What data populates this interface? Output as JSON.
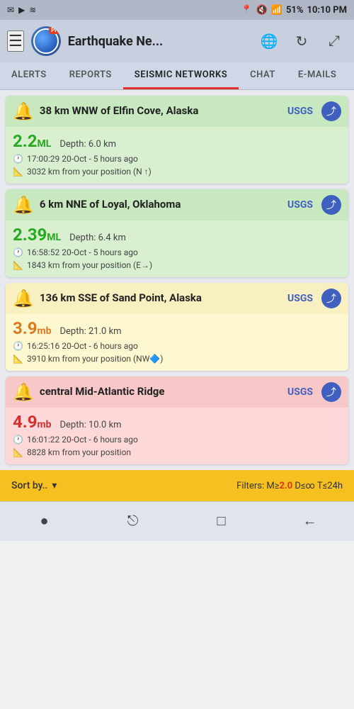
{
  "statusBar": {
    "leftIcons": [
      "✉",
      "▶",
      "≋"
    ],
    "rightItems": [
      "51%",
      "10:10 PM"
    ]
  },
  "header": {
    "title": "Earthquake Ne...",
    "menuIcon": "☰",
    "globeIcon": "🌐",
    "refreshIcon": "↻",
    "expandIcon": "⤢",
    "proBadge": "Pro"
  },
  "tabs": [
    {
      "id": "alerts",
      "label": "ALERTS",
      "active": false
    },
    {
      "id": "reports",
      "label": "REPORTS",
      "active": false
    },
    {
      "id": "seismic",
      "label": "SEISMIC NETWORKS",
      "active": true
    },
    {
      "id": "chat",
      "label": "CHAT",
      "active": false
    },
    {
      "id": "emails",
      "label": "E-MAILS",
      "active": false
    }
  ],
  "earthquakes": [
    {
      "id": "eq1",
      "color": "green",
      "location": "38 km WNW of Elfin Cove, Alaska",
      "source": "USGS",
      "magnitude": "2.2",
      "magType": "ML",
      "depth": "Depth: 6.0 km",
      "time": "17:00:29 20-Oct - 5 hours ago",
      "distance": "3032 km from your position (N ↑)"
    },
    {
      "id": "eq2",
      "color": "green",
      "location": "6 km NNE of Loyal, Oklahoma",
      "source": "USGS",
      "magnitude": "2.39",
      "magType": "ML",
      "depth": "Depth: 6.4 km",
      "time": "16:58:52 20-Oct - 5 hours ago",
      "distance": "1843 km from your position (E→)"
    },
    {
      "id": "eq3",
      "color": "yellow",
      "location": "136 km SSE of Sand Point, Alaska",
      "source": "USGS",
      "magnitude": "3.9",
      "magType": "mb",
      "depth": "Depth: 21.0 km",
      "time": "16:25:16 20-Oct - 6 hours ago",
      "distance": "3910 km from your position (NW🔷)"
    },
    {
      "id": "eq4",
      "color": "pink",
      "location": "central Mid-Atlantic Ridge",
      "source": "USGS",
      "magnitude": "4.9",
      "magType": "mb",
      "depth": "Depth: 10.0 km",
      "time": "16:01:22 20-Oct - 6 hours ago",
      "distance": "8828 km from your position"
    }
  ],
  "bottomBar": {
    "sortLabel": "Sort by..",
    "filterText": "Filters: M≥",
    "filterMag": "2.0",
    "filterRest": " D≤∞ T≤24h"
  },
  "navBar": {
    "homeIcon": "●",
    "recentIcon": "⎋",
    "squareIcon": "□",
    "backIcon": "←"
  },
  "magnitudeColors": {
    "green": "#28a820",
    "orange": "#e07820",
    "red": "#d03030"
  }
}
